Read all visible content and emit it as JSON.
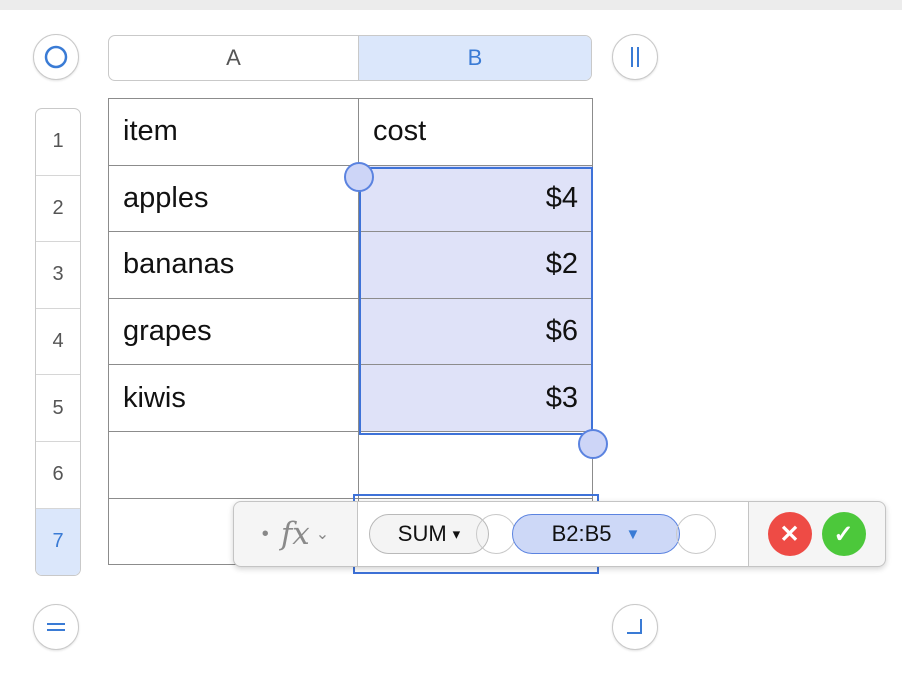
{
  "columns": [
    "A",
    "B"
  ],
  "rows": [
    {
      "num": "1",
      "item": "item",
      "cost": "cost"
    },
    {
      "num": "2",
      "item": "apples",
      "cost": "$4"
    },
    {
      "num": "3",
      "item": "bananas",
      "cost": "$2"
    },
    {
      "num": "4",
      "item": "grapes",
      "cost": "$6"
    },
    {
      "num": "5",
      "item": "kiwis",
      "cost": "$3"
    },
    {
      "num": "6",
      "item": "",
      "cost": ""
    },
    {
      "num": "7",
      "item": "",
      "cost": ""
    }
  ],
  "formula_bar": {
    "fx_label": "fx",
    "function_token": "SUM",
    "function_arrow": "▾",
    "range_token": "B2:B5",
    "range_arrow": "▼",
    "cancel_glyph": "✕",
    "accept_glyph": "✓"
  },
  "icons": {
    "top_left": "circle-select-table-icon",
    "top_right": "column-pause-icon",
    "bottom_left": "row-equals-icon",
    "bottom_right": "resize-corner-icon"
  },
  "colors": {
    "selection_fill": "#dfe2f8",
    "selection_border": "#3e72d8",
    "header_selected": "#dbe7fb",
    "cancel": "#ee4b45",
    "accept": "#4cc83b"
  }
}
